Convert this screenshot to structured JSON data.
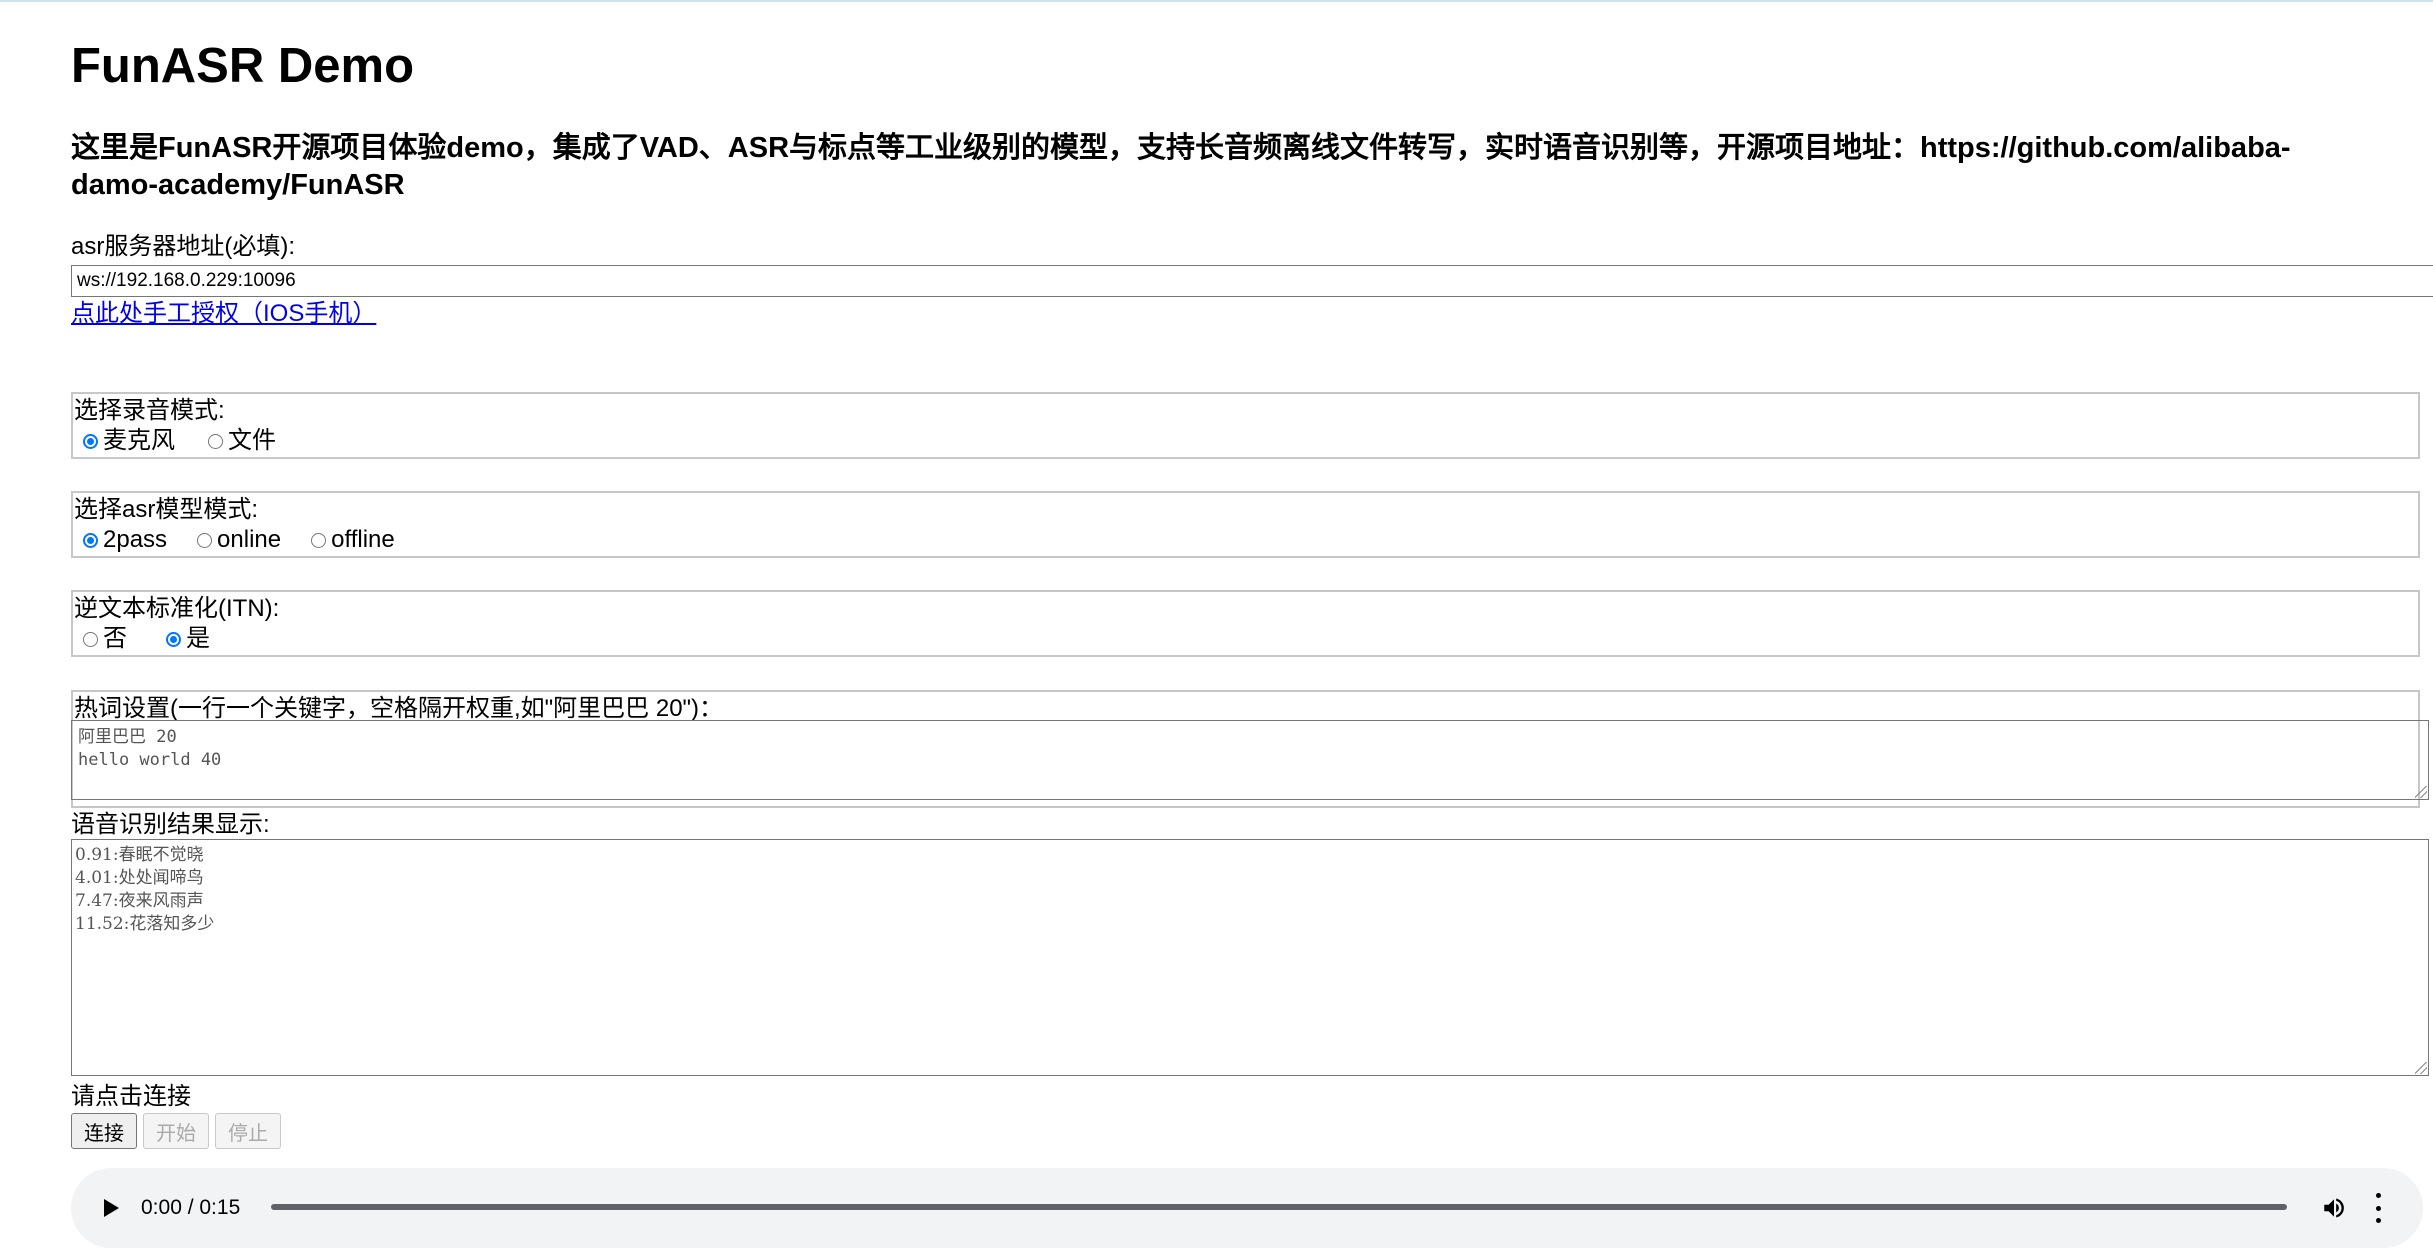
{
  "page": {
    "title": "FunASR Demo",
    "intro": "这里是FunASR开源项目体验demo，集成了VAD、ASR与标点等工业级别的模型，支持长音频离线文件转写，实时语音识别等，开源项目地址：https://github.com/alibaba-damo-academy/FunASR"
  },
  "server": {
    "label": "asr服务器地址(必填):",
    "value": "ws://192.168.0.229:10096",
    "ios_link": "点此处手工授权（IOS手机）"
  },
  "record_mode": {
    "label": "选择录音模式:",
    "options": [
      {
        "label": "麦克风",
        "selected": true
      },
      {
        "label": "文件",
        "selected": false
      }
    ]
  },
  "model_mode": {
    "label": "选择asr模型模式:",
    "options": [
      {
        "label": "2pass",
        "selected": true
      },
      {
        "label": "online",
        "selected": false
      },
      {
        "label": "offline",
        "selected": false
      }
    ]
  },
  "itn": {
    "label": "逆文本标准化(ITN):",
    "options": [
      {
        "label": "否",
        "selected": false
      },
      {
        "label": "是",
        "selected": true
      }
    ]
  },
  "hotwords": {
    "label": "热词设置(一行一个关键字，空格隔开权重,如\"阿里巴巴 20\")：",
    "value": "阿里巴巴 20\nhello world 40"
  },
  "result": {
    "label": "语音识别结果显示:",
    "value": "0.91:春眠不觉晓\n4.01:处处闻啼鸟\n7.47:夜来风雨声\n11.52:花落知多少"
  },
  "status": "请点击连接",
  "buttons": {
    "connect": "连接",
    "start": "开始",
    "stop": "停止"
  },
  "player": {
    "time": "0:00 / 0:15",
    "icons": [
      "play-icon",
      "volume-icon",
      "more-options-icon"
    ]
  }
}
